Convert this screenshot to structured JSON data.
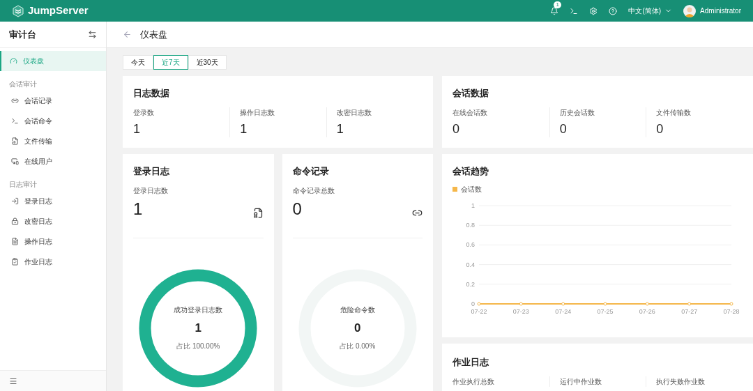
{
  "header": {
    "logo": "JumpServer",
    "notifications": "1",
    "language": "中文(简体)",
    "user": "Administrator"
  },
  "sidebar": {
    "title": "审计台",
    "items": [
      {
        "kind": "item",
        "label": "仪表盘",
        "selected": true
      },
      {
        "kind": "group",
        "label": "会话审计"
      },
      {
        "kind": "item",
        "label": "会话记录",
        "selected": false
      },
      {
        "kind": "item",
        "label": "会话命令",
        "selected": false
      },
      {
        "kind": "item",
        "label": "文件传输",
        "selected": false
      },
      {
        "kind": "item",
        "label": "在线用户",
        "selected": false
      },
      {
        "kind": "group",
        "label": "日志审计"
      },
      {
        "kind": "item",
        "label": "登录日志",
        "selected": false
      },
      {
        "kind": "item",
        "label": "改密日志",
        "selected": false
      },
      {
        "kind": "item",
        "label": "操作日志",
        "selected": false
      },
      {
        "kind": "item",
        "label": "作业日志",
        "selected": false
      }
    ]
  },
  "page": {
    "title": "仪表盘"
  },
  "tabs": [
    {
      "label": "今天",
      "selected": false
    },
    {
      "label": "近7天",
      "selected": true
    },
    {
      "label": "近30天",
      "selected": false
    }
  ],
  "log_data": {
    "title": "日志数据",
    "stats": [
      {
        "label": "登录数",
        "value": "1"
      },
      {
        "label": "操作日志数",
        "value": "1"
      },
      {
        "label": "改密日志数",
        "value": "1"
      }
    ]
  },
  "session_data": {
    "title": "会话数据",
    "stats": [
      {
        "label": "在线会话数",
        "value": "0"
      },
      {
        "label": "历史会话数",
        "value": "0"
      },
      {
        "label": "文件传输数",
        "value": "0"
      }
    ]
  },
  "login_log": {
    "title": "登录日志",
    "label": "登录日志数",
    "value": "1",
    "ring": {
      "label": "成功登录日志数",
      "value": "1",
      "ratio": "占比 100.00%",
      "level": 1
    }
  },
  "command_log": {
    "title": "命令记录",
    "label": "命令记录总数",
    "value": "0",
    "ring": {
      "label": "危险命令数",
      "value": "0",
      "ratio": "占比 0.00%",
      "level": 0
    }
  },
  "session_trend": {
    "title": "会话趋势",
    "chart_data": {
      "type": "line",
      "categories": [
        "07-22",
        "07-23",
        "07-24",
        "07-25",
        "07-26",
        "07-27",
        "07-28"
      ],
      "series": [
        {
          "name": "会话数",
          "color": "#f5b74a",
          "values": [
            0,
            0,
            0,
            0,
            0,
            0,
            0
          ]
        }
      ],
      "ylim": [
        0,
        1
      ],
      "grid": true,
      "marker": true,
      "yticks": [
        {
          "value": 0,
          "label": "0"
        },
        {
          "value": 0.2,
          "label": "0.2"
        },
        {
          "value": 0.4,
          "label": "0.4"
        },
        {
          "value": 0.6,
          "label": "0.6"
        },
        {
          "value": 0.8,
          "label": "0.8"
        },
        {
          "value": 1,
          "label": "1"
        }
      ]
    }
  },
  "job_log": {
    "title": "作业日志",
    "stats": [
      {
        "label": "作业执行总数"
      },
      {
        "label": "运行中作业数"
      },
      {
        "label": "执行失败作业数"
      }
    ]
  }
}
